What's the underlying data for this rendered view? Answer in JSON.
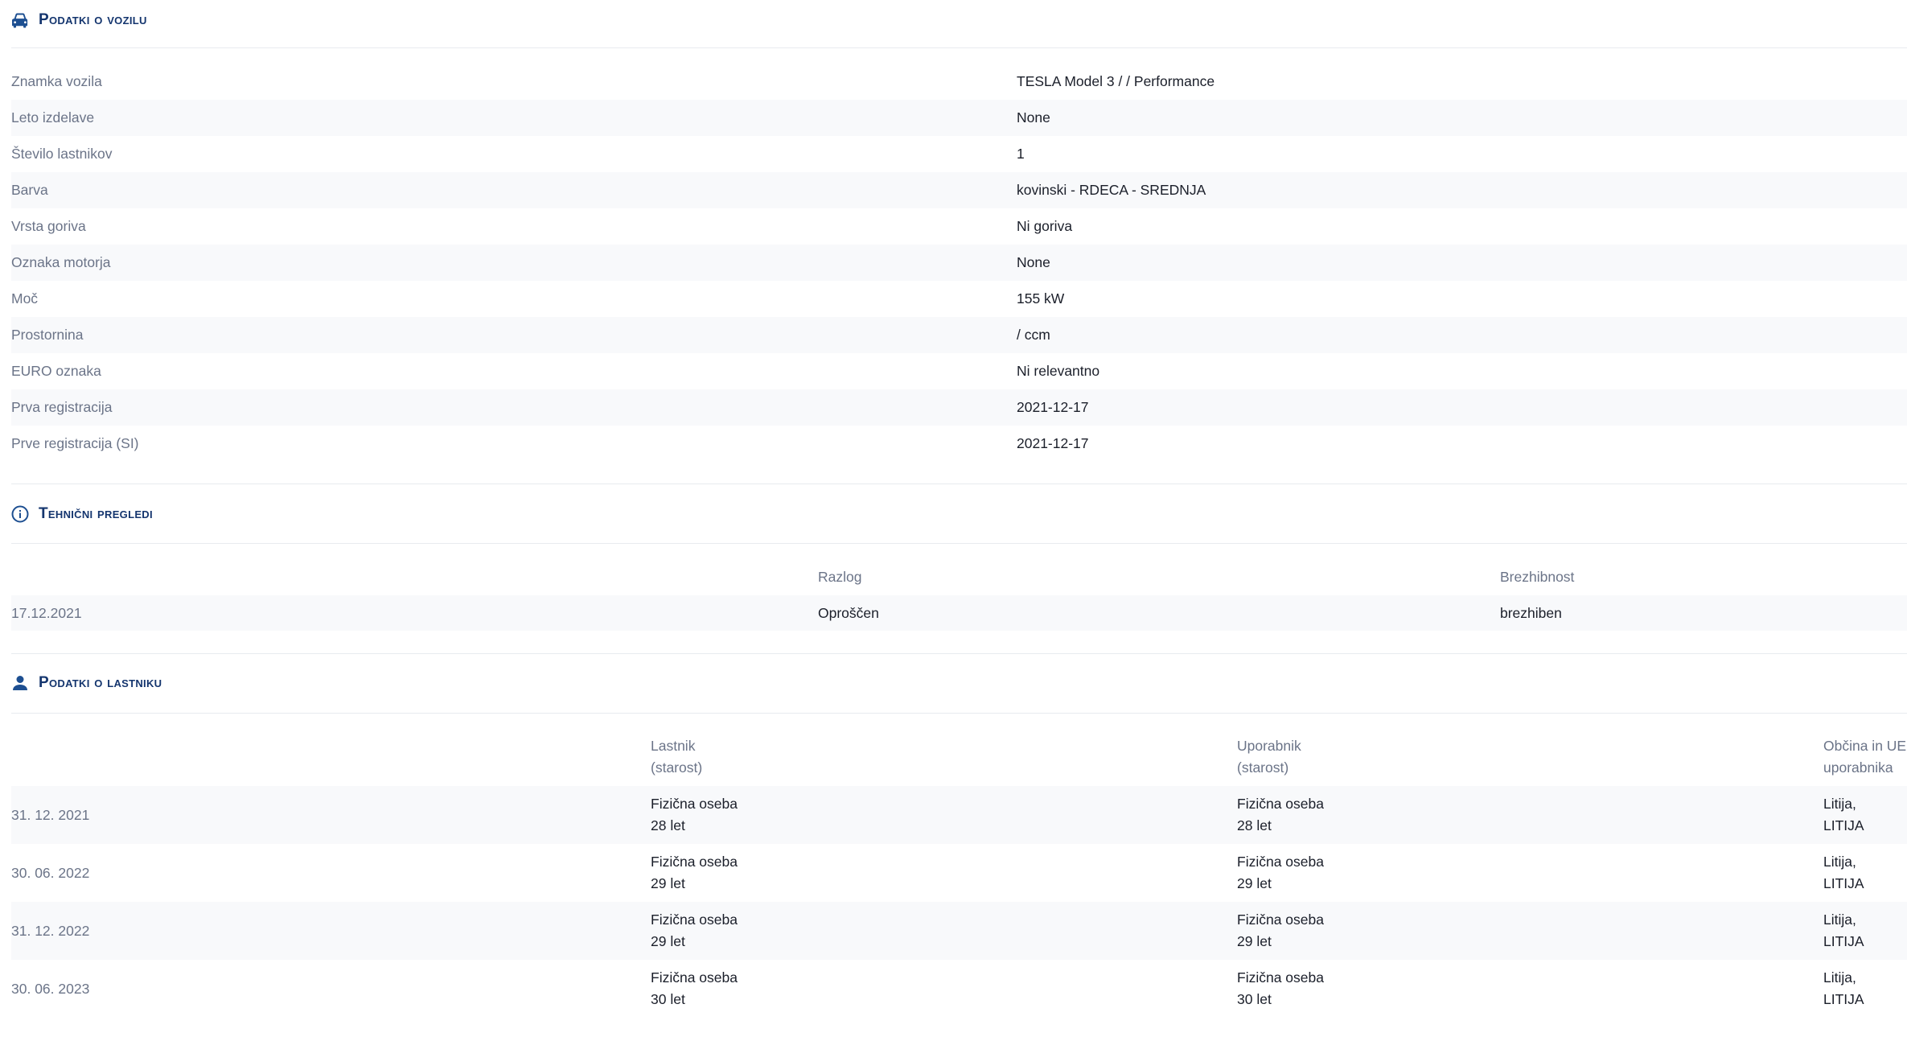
{
  "colors": {
    "section_title": "#14356e",
    "label": "#6b7488",
    "row_shade": "#f8f9fb",
    "icon": "#1d4f91"
  },
  "vehicle": {
    "title": "Podatki o vozilu",
    "icon": "car-icon",
    "rows": [
      {
        "label": "Znamka vozila",
        "value": "TESLA Model 3 / / Performance"
      },
      {
        "label": "Leto izdelave",
        "value": "None"
      },
      {
        "label": "Število lastnikov",
        "value": "1"
      },
      {
        "label": "Barva",
        "value": "kovinski - RDECA - SREDNJA"
      },
      {
        "label": "Vrsta goriva",
        "value": "Ni goriva"
      },
      {
        "label": "Oznaka motorja",
        "value": "None"
      },
      {
        "label": "Moč",
        "value": "155 kW"
      },
      {
        "label": "Prostornina",
        "value": "/ ccm"
      },
      {
        "label": "EURO oznaka",
        "value": "Ni relevantno"
      },
      {
        "label": "Prva registracija",
        "value": "2021-12-17"
      },
      {
        "label": "Prve registracija (SI)",
        "value": "2021-12-17"
      }
    ]
  },
  "inspections": {
    "title": "Tehnični pregledi",
    "icon": "info-circle-icon",
    "headers": {
      "reason": "Razlog",
      "condition": "Brezhibnost"
    },
    "rows": [
      {
        "date": "17.12.2021",
        "reason": "Oproščen",
        "condition": "brezhiben"
      }
    ]
  },
  "owners": {
    "title": "Podatki o lastniku",
    "icon": "person-icon",
    "headers": {
      "owner_1": "Lastnik",
      "owner_2": "(starost)",
      "user_1": "Uporabnik",
      "user_2": "(starost)",
      "municipality_1": "Občina in UE",
      "municipality_2": "uporabnika"
    },
    "rows": [
      {
        "date": "31. 12. 2021",
        "owner_type": "Fizična oseba",
        "owner_age": "28 let",
        "user_type": "Fizična oseba",
        "user_age": "28 let",
        "municipality": "Litija,",
        "ue": "LITIJA"
      },
      {
        "date": "30. 06. 2022",
        "owner_type": "Fizična oseba",
        "owner_age": "29 let",
        "user_type": "Fizična oseba",
        "user_age": "29 let",
        "municipality": "Litija,",
        "ue": "LITIJA"
      },
      {
        "date": "31. 12. 2022",
        "owner_type": "Fizična oseba",
        "owner_age": "29 let",
        "user_type": "Fizična oseba",
        "user_age": "29 let",
        "municipality": "Litija,",
        "ue": "LITIJA"
      },
      {
        "date": "30. 06. 2023",
        "owner_type": "Fizična oseba",
        "owner_age": "30 let",
        "user_type": "Fizična oseba",
        "user_age": "30 let",
        "municipality": "Litija,",
        "ue": "LITIJA"
      }
    ]
  }
}
